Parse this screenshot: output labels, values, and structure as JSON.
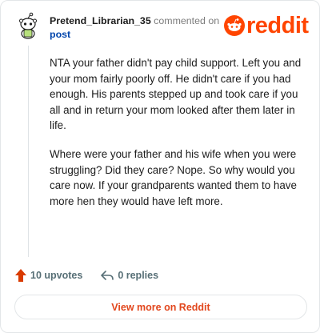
{
  "header": {
    "username": "Pretend_Librarian_35",
    "action_text": "commented on",
    "post_link": "post",
    "brand_word": "reddit"
  },
  "comment": {
    "paragraphs": [
      "NTA your father didn't pay child support. Left you and your mom fairly poorly off. He didn't care if you had enough. His parents stepped up and took care if you all and in return your mom looked after them later in life.",
      "Where were your father and his wife when you were struggling? Did they care? Nope. So why would you care now. If your grandparents wanted them to have more hen they would have left more."
    ]
  },
  "actions": {
    "upvotes": "10 upvotes",
    "replies": "0 replies"
  },
  "footer": {
    "view_more": "View more on Reddit"
  },
  "colors": {
    "brand": "#ff4500",
    "link": "#0045ac",
    "muted": "#576f76"
  },
  "icons": {
    "avatar": "snoo-avatar-icon",
    "brand": "reddit-snoo-logo-icon",
    "upvote": "upvote-arrow-icon",
    "reply": "reply-arrow-icon"
  }
}
